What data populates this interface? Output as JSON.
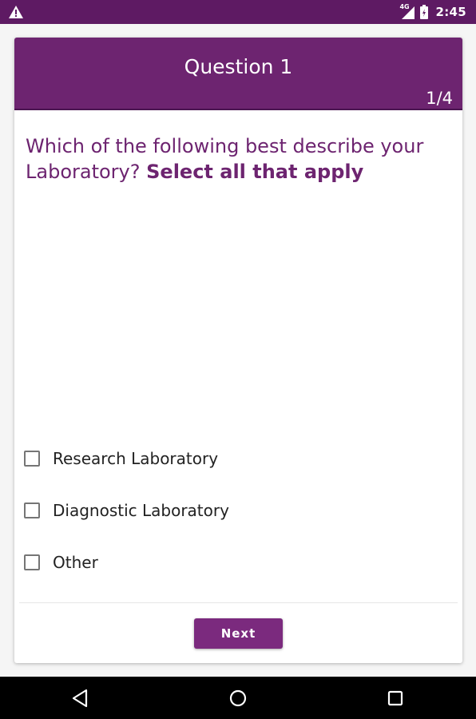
{
  "status_bar": {
    "time": "2:45",
    "network_tag": "4G",
    "icons": [
      "warning-icon",
      "signal-icon",
      "battery-icon"
    ]
  },
  "header": {
    "title": "Question 1",
    "progress": "1/4"
  },
  "question": {
    "text": "Which of the following best describe your Laboratory?",
    "emphasis": "Select all that apply"
  },
  "options": [
    {
      "label": "Research Laboratory",
      "checked": false
    },
    {
      "label": "Diagnostic Laboratory",
      "checked": false
    },
    {
      "label": "Other",
      "checked": false
    }
  ],
  "footer": {
    "next_label": "Next"
  },
  "nav_bar": {
    "icons": [
      "back-icon",
      "home-icon",
      "recent-apps-icon"
    ]
  },
  "colors": {
    "status_bar": "#5e1a63",
    "header": "#6d2470",
    "question_text": "#6d2470",
    "button": "#7b2a7e"
  }
}
